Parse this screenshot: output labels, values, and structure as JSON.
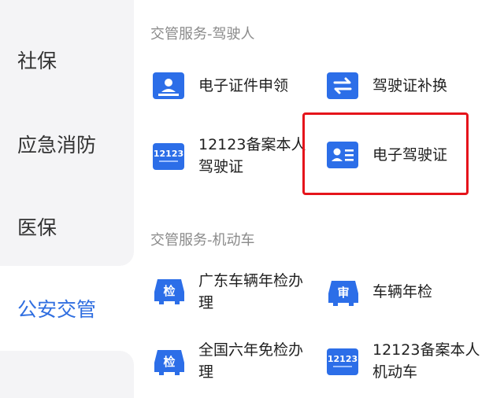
{
  "sidebar": {
    "items": [
      {
        "label": "社保",
        "active": false
      },
      {
        "label": "应急消防",
        "active": false
      },
      {
        "label": "医保",
        "active": false
      },
      {
        "label": "公安交管",
        "active": true
      }
    ]
  },
  "sections": [
    {
      "title": "交管服务-驾驶人",
      "services": [
        {
          "label": "电子证件申领",
          "icon": "certificate-icon"
        },
        {
          "label": "驾驶证补换",
          "icon": "swap-icon"
        },
        {
          "label_line1": "12123备案本人",
          "label_line2": "驾驶证",
          "icon": "12123-logo-icon",
          "icon_text": "12123"
        },
        {
          "label": "电子驾驶证",
          "icon": "id-card-icon"
        }
      ]
    },
    {
      "title": "交管服务-机动车",
      "services": [
        {
          "label_line1": "广东车辆年检办",
          "label_line2": "理",
          "icon": "inspection-car-icon",
          "icon_text": "检"
        },
        {
          "label": "车辆年检",
          "icon": "vehicle-inspection-icon",
          "icon_text": "审"
        },
        {
          "label_line1": "全国六年免检办",
          "label_line2": "理",
          "icon": "exempt-inspection-car-icon",
          "icon_text": "检"
        },
        {
          "label_line1": "12123备案本人",
          "label_line2": "机动车",
          "icon": "12123-logo-icon",
          "icon_text": "12123"
        }
      ]
    }
  ],
  "colors": {
    "accent": "#2f6ee0",
    "highlight": "#e5141b",
    "icon_blue": "#2c6ee8"
  }
}
